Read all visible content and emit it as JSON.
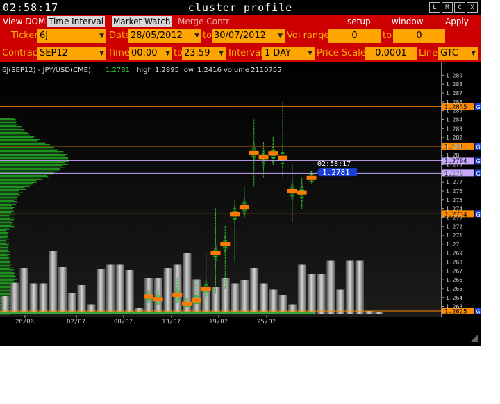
{
  "window": {
    "clock": "02:58:17",
    "title": "cluster profile",
    "controls": [
      "L",
      "M",
      "C",
      "X"
    ]
  },
  "menubar": {
    "left": [
      {
        "label": "View DOM",
        "state": "normal"
      },
      {
        "label": "Time Interval",
        "state": "active"
      },
      {
        "label": "Market Watch",
        "state": "active"
      },
      {
        "label": "Merge Contr",
        "state": "dim"
      }
    ],
    "right": [
      "setup",
      "window",
      "Apply"
    ]
  },
  "filters": {
    "ticker_label": "Ticker",
    "ticker": "6J",
    "date_label": "Date",
    "date_from": "28/05/2012",
    "to1": "to",
    "date_to": "30/07/2012",
    "vol_range_label": "Vol range",
    "vol_from": "0",
    "to2": "to",
    "vol_to": "0",
    "contract_label": "Contract",
    "contract": "SEP12",
    "time_label": "Time",
    "time_from": "00:00",
    "to3": "to",
    "time_to": "23:59",
    "interval_label": "Interval",
    "interval": "1 DAY",
    "price_scale_label": "Price Scale",
    "price_scale": "0.0001",
    "line_label": "Line",
    "line": "GTC"
  },
  "colors": {
    "menubar": "#cc0000",
    "field": "#ffa500",
    "label": "#ffb000",
    "green": "#2fb52f",
    "orange": "#ff8c00",
    "lilac": "#c8a8ff",
    "blue": "#1a3fd9"
  },
  "chart_data": {
    "type": "bar",
    "header": {
      "symbol": "6J(SEP12) - JPY/USD(CME)",
      "last": "1.2781",
      "high_label": "high",
      "high": "1.2895",
      "low_label": "low",
      "low": "1.2416",
      "volume_label": "volume",
      "volume": "2110755"
    },
    "y_ticks": [
      "1.289",
      "1.288",
      "1.287",
      "1.286",
      "1.285",
      "1.284",
      "1.283",
      "1.282",
      "1.281",
      "1.28",
      "1.279",
      "1.278",
      "1.277",
      "1.276",
      "1.275",
      "1.274",
      "1.273",
      "1.272",
      "1.271",
      "1.27",
      "1.269",
      "1.268",
      "1.267",
      "1.266",
      "1.265",
      "1.264",
      "1.263"
    ],
    "x_ticks": [
      "26/06",
      "02/07",
      "08/07",
      "13/07",
      "19/07",
      "25/07"
    ],
    "cursor_time": "02:58:17",
    "last_price": "1.2781",
    "levels": [
      {
        "price": 1.2855,
        "label": "1.2855",
        "color": "orange",
        "tag": "G"
      },
      {
        "price": 1.281,
        "label": "1.281",
        "color": "orange",
        "tag": "G"
      },
      {
        "price": 1.2794,
        "label": "1.2794",
        "color": "lilac",
        "tag": "G"
      },
      {
        "price": 1.278,
        "label": "1.278",
        "color": "lilac",
        "tag": "G"
      },
      {
        "price": 1.2734,
        "label": "1.2734",
        "color": "orange",
        "tag": "G"
      },
      {
        "price": 1.2625,
        "label": "1.2625",
        "color": "orange",
        "tag": "G"
      }
    ],
    "volume_bars": [
      0.17,
      0.3,
      0.44,
      0.29,
      0.29,
      0.6,
      0.45,
      0.2,
      0.28,
      0.09,
      0.43,
      0.47,
      0.47,
      0.42,
      0.06,
      0.34,
      0.34,
      0.44,
      0.47,
      0.58,
      0.33,
      0.22,
      0.26,
      0.34,
      0.29,
      0.32,
      0.44,
      0.29,
      0.23,
      0.18,
      0.09,
      0.47,
      0.38,
      0.38,
      0.51,
      0.23,
      0.51,
      0.51,
      0.03,
      0.02
    ],
    "day_clusters": [
      {
        "i": 15,
        "lo": 1.2635,
        "hi": 1.2648,
        "poc": 1.2641
      },
      {
        "i": 16,
        "lo": 1.2632,
        "hi": 1.2652,
        "poc": 1.2638
      },
      {
        "i": 18,
        "lo": 1.2634,
        "hi": 1.2662,
        "poc": 1.2643
      },
      {
        "i": 19,
        "lo": 1.2628,
        "hi": 1.264,
        "poc": 1.2633
      },
      {
        "i": 20,
        "lo": 1.2632,
        "hi": 1.266,
        "poc": 1.2637
      },
      {
        "i": 21,
        "lo": 1.2635,
        "hi": 1.269,
        "poc": 1.265
      },
      {
        "i": 22,
        "lo": 1.2645,
        "hi": 1.274,
        "poc": 1.269
      },
      {
        "i": 23,
        "lo": 1.265,
        "hi": 1.272,
        "poc": 1.27
      },
      {
        "i": 24,
        "lo": 1.268,
        "hi": 1.275,
        "poc": 1.2734
      },
      {
        "i": 25,
        "lo": 1.273,
        "hi": 1.2765,
        "poc": 1.2742
      },
      {
        "i": 26,
        "lo": 1.2765,
        "hi": 1.284,
        "poc": 1.2803
      },
      {
        "i": 27,
        "lo": 1.2775,
        "hi": 1.2815,
        "poc": 1.2798
      },
      {
        "i": 28,
        "lo": 1.279,
        "hi": 1.282,
        "poc": 1.2802
      },
      {
        "i": 29,
        "lo": 1.2775,
        "hi": 1.286,
        "poc": 1.2797
      },
      {
        "i": 30,
        "lo": 1.2725,
        "hi": 1.279,
        "poc": 1.276
      },
      {
        "i": 31,
        "lo": 1.274,
        "hi": 1.2775,
        "poc": 1.2758
      },
      {
        "i": 32,
        "lo": 1.2768,
        "hi": 1.2782,
        "poc": 1.2775
      }
    ]
  }
}
